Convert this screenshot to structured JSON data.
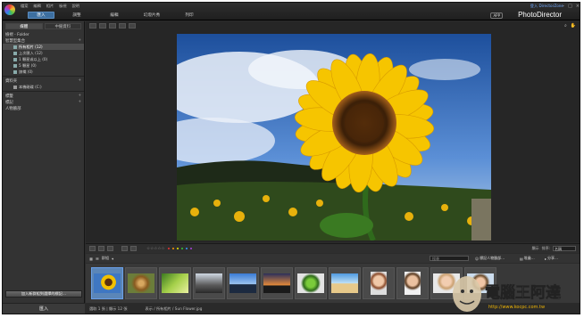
{
  "titlebar": {
    "menu": [
      "檔案",
      "編輯",
      "相片",
      "檢視",
      "說明"
    ],
    "modes": [
      "匯入",
      "調整",
      "編輯",
      "幻燈片秀",
      "列印"
    ],
    "active_mode": "匯入",
    "topright_link": "登入 DirectorZone",
    "app_badge": "APP",
    "brand": "PhotoDirector"
  },
  "left_panel": {
    "tabs": [
      "媒體",
      "中繼資料"
    ],
    "active_tab": "媒體",
    "header": "檢視 - Folder",
    "library_title": "智慧型集合",
    "library_items": [
      "所有相片 (12)",
      "上次匯入 (12)",
      "1 顆星或以上 (0)",
      "5 顆星 (0)",
      "旗幟 (0)"
    ],
    "folder_title": "資料夾",
    "folder_items": [
      "本機磁碟 (C:)"
    ],
    "section_tags": "標籤",
    "section_people": "標記",
    "section_faces": "人物臉部",
    "bottom_button": "加入新群組到選擇的標記…",
    "import_button": "匯入"
  },
  "navigation": {
    "sort_label": "排序:",
    "sort_value": "名稱",
    "zoom_label": "顯示"
  },
  "browser": {
    "search_placeholder": "搜尋",
    "btn_people": "標記人物臉部…",
    "btn_stack": "堆疊…",
    "btn_share": "分享…",
    "label_select": "群組"
  },
  "thumbnails": [
    "sunflower",
    "snail",
    "green",
    "rocks",
    "city",
    "sunset",
    "frog",
    "beach",
    "girl",
    "man",
    "woman",
    "smile"
  ],
  "statusbar": {
    "count": "選取 1 張 | 顯示 12 張",
    "path": "表示 / 所有相片 / Sun Flower.jpg"
  },
  "colors": {
    "accent": "#3d6fa0",
    "panel_bg": "#333333",
    "app_bg": "#2b2b2b",
    "selected": "#5b86b8"
  },
  "watermark": {
    "text": "電腦王阿達",
    "url": "http://www.kocpc.com.tw"
  }
}
